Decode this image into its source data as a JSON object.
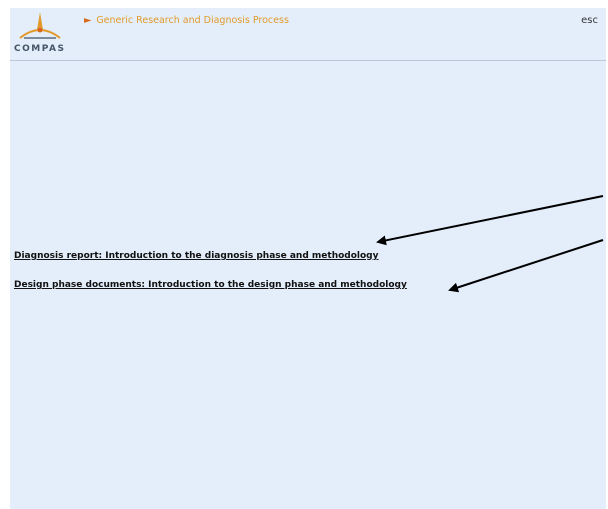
{
  "header": {
    "logo_text": "COMPAS",
    "breadcrumb": "Generic Research and Diagnosis Process",
    "esc_label": "esc"
  },
  "links": [
    {
      "label": "Diagnosis report: Introduction to the diagnosis phase and methodology"
    },
    {
      "label": "Design phase documents: Introduction to the design phase and methodology"
    }
  ],
  "colors": {
    "background": "#e3eefa",
    "breadcrumb": "#e29a2b",
    "arrow": "#000000"
  }
}
